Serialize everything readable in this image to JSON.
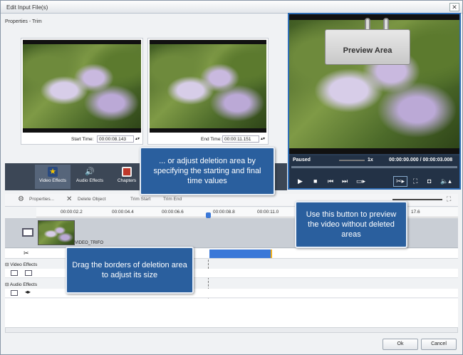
{
  "window": {
    "title": "Edit Input File(s)",
    "close": "✕"
  },
  "panel": {
    "title": "Properties - Trim"
  },
  "left_frame": {
    "time_label": "Start Time:",
    "time_value": "00:00:08.143"
  },
  "right_frame": {
    "time_label": "End Time:",
    "time_value": "00:00:11.151"
  },
  "preview": {
    "tag": "Preview Area",
    "status": "Paused",
    "speed": "1x",
    "time": "00:00:00.000 / 00:00:03.008"
  },
  "tabs": [
    {
      "label": "Video Effects",
      "icon": "star-icon"
    },
    {
      "label": "Audio Effects",
      "icon": "speaker-icon"
    },
    {
      "label": "Chapters",
      "icon": "film-icon"
    }
  ],
  "toolbar": {
    "properties": "Properties...",
    "delete": "Delete Object",
    "trim_start": "Trim Start",
    "trim_end": "Trim End"
  },
  "ruler": {
    "ticks": [
      "00:00:02.2",
      "00:00:04.4",
      "00:00:06.6",
      "00:00:08.8",
      "00:00:11.0",
      "17.6"
    ]
  },
  "timeline": {
    "clip_label": "VIDEO_TRIFO",
    "video_effects": "Video Effects",
    "audio_effects": "Audio Effects"
  },
  "callouts": {
    "adjust_time": "... or adjust deletion area by specifying the starting and final time values",
    "preview_button": "Use this button to preview the video without deleted areas",
    "drag_borders": "Drag the borders of deletion area to adjust its size"
  },
  "buttons": {
    "ok": "Ok",
    "cancel": "Cancel"
  },
  "colors": {
    "accent": "#2f6db5",
    "callout": "#2a5f9e",
    "deletion": "#3a78d8"
  }
}
